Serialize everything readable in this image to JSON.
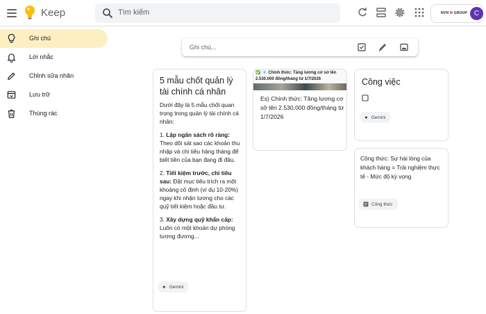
{
  "header": {
    "app_name": "Keep",
    "search_placeholder": "Tìm kiếm",
    "org_name": "NVN",
    "org_mark": "M",
    "org_suffix": "GROUP",
    "avatar_initial": "C"
  },
  "sidebar": {
    "items": [
      {
        "label": "Ghi chú",
        "icon": "lightbulb-icon",
        "active": true
      },
      {
        "label": "Lời nhắc",
        "icon": "bell-icon",
        "active": false
      },
      {
        "label": "Chỉnh sửa nhãn",
        "icon": "pencil-icon",
        "active": false
      },
      {
        "label": "Lưu trữ",
        "icon": "archive-icon",
        "active": false
      },
      {
        "label": "Thùng rác",
        "icon": "trash-icon",
        "active": false
      }
    ]
  },
  "take_note": {
    "placeholder": "Ghi chú..."
  },
  "notes": {
    "finance": {
      "title": "5 mẫu chốt quản lý tài chính cá nhân",
      "intro": "Dưới đây là 5 mẫu chốt quan trọng trong quản lý tài chính cá nhân:",
      "p1_head": "1. ",
      "p1_bold": "Lập ngân sách rõ ràng:",
      "p1_text": " Theo dõi sát sao các khoản thu nhập và chi tiêu hàng tháng để biết tiền của bạn đang đi đâu.",
      "p2_head": "2. ",
      "p2_bold": "Tiết kiệm trước, chi tiêu sau:",
      "p2_text": " Đặt mục tiêu trích ra một khoảng cố định (ví dụ 10-20%) ngay khi nhận lương cho các quỹ tiết kiệm hoặc đầu tư.",
      "p3_head": "3. ",
      "p3_bold": "Xây dựng quỹ khẩn cấp:",
      "p3_text": " Luôn có một khoản dự phòng tương đương...",
      "chip": "Gemini"
    },
    "salary": {
      "image_caption_1": "✅ 📧 Chính thức: Tăng lương cơ sở lên",
      "image_caption_2": "2.530.000 đồng/tháng từ 1/7/2026",
      "body": "Es) Chính thức: Tăng lương cơ sở lên 2.530.000 đồng/tháng từ 1/7/2026"
    },
    "work": {
      "title": "Công việc",
      "chip": "Gemini"
    },
    "formula": {
      "body": "Công thức: Sự hài lòng của khách hàng = Trải nghiệm thực tế  - Mức độ kỳ vọng",
      "label_chip": "Công thức"
    }
  },
  "colors": {
    "accent_active": "#feefc3",
    "logo_yellow": "#fbbc04",
    "avatar": "#5e35b1"
  }
}
